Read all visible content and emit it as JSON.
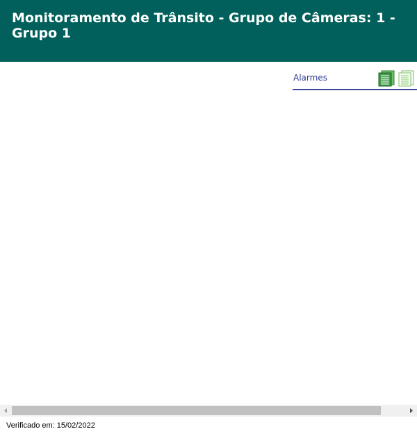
{
  "header": {
    "title": "Monitoramento de Trânsito - Grupo de Câmeras: 1 - Grupo 1",
    "background": "#01605b"
  },
  "alarm_panel": {
    "label": "Alarmes",
    "label_color": "#2a3a8f",
    "icons": [
      "list-view-icon",
      "document-view-icon"
    ]
  },
  "footer": {
    "verified_text": "Verificado em: 15/02/2022"
  }
}
